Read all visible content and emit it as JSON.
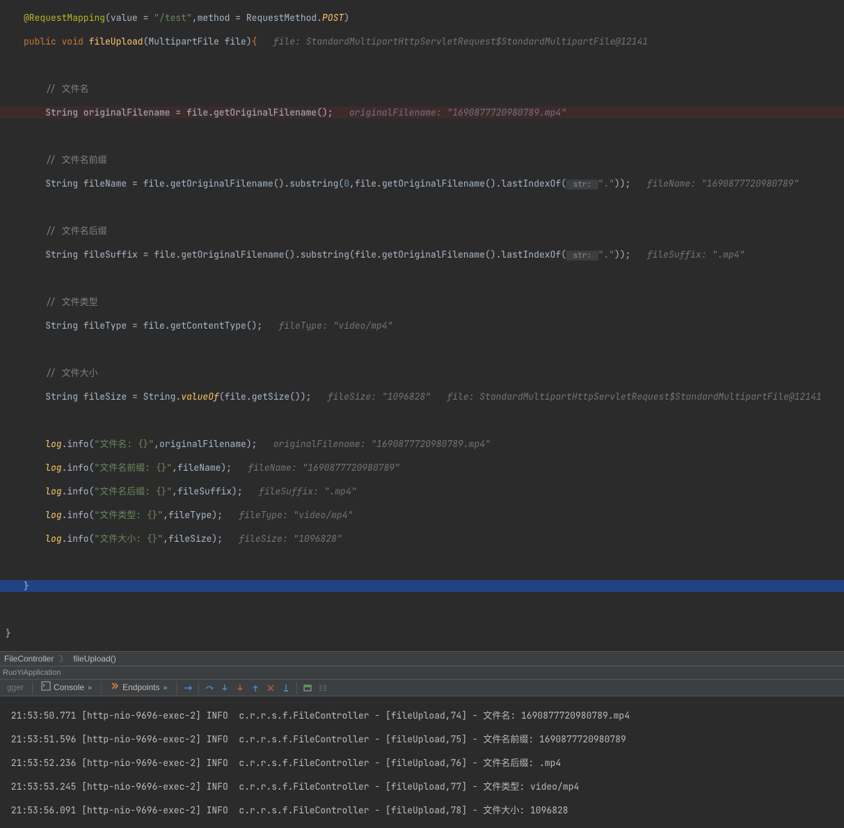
{
  "code": {
    "l1": {
      "ann": "@RequestMapping",
      "p1": "(value = ",
      "s1": "\"/test\"",
      "p2": ",method = RequestMethod.",
      "en": "POST",
      "p3": ")"
    },
    "l2": {
      "mods": "public void ",
      "name": "fileUpload",
      "sig": "(MultipartFile file)",
      "ob": "{",
      "hint": "   file: StandardMultipartHttpServletRequest$StandardMultipartFile@12141"
    },
    "l3": "",
    "l4": {
      "c": "    // 文件名"
    },
    "l5": {
      "t": "    String originalFilename = file.getOriginalFilename();",
      "h": "   originalFilename: \"1690877720980789.mp4\""
    },
    "l6": "",
    "l7": {
      "c": "    // 文件名前缀"
    },
    "l8": {
      "pre": "    String fileName = file.getOriginalFilename().substring(",
      "n": "0",
      "mid": ",file.getOriginalFilename().lastIndexOf(",
      "ph": " str: ",
      "s": "\".\"",
      "post": "));",
      "h": "   fileName: \"1690877720980789\""
    },
    "l9": "",
    "l10": {
      "c": "    // 文件名后缀"
    },
    "l11": {
      "pre": "    String fileSuffix = file.getOriginalFilename().substring(file.getOriginalFilename().lastIndexOf(",
      "ph": " str: ",
      "s": "\".\"",
      "post": "));",
      "h": "   fileSuffix: \".mp4\""
    },
    "l12": "",
    "l13": {
      "c": "    // 文件类型"
    },
    "l14": {
      "t": "    String fileType = file.getContentType();",
      "h": "   fileType: \"video/mp4\""
    },
    "l15": "",
    "l16": {
      "c": "    // 文件大小"
    },
    "l17": {
      "pre": "    String fileSize = String.",
      "m": "valueOf",
      "post": "(file.getSize());",
      "h": "   fileSize: \"1096828\"   file: StandardMultipartHttpServletRequest$StandardMultipartFile@12141"
    },
    "l18": "",
    "l19": {
      "log": "    log",
      "call": ".info(",
      "s": "\"文件名: {}\"",
      "mid": ",originalFilename);",
      "h": "   originalFilename: \"1690877720980789.mp4\""
    },
    "l20": {
      "log": "    log",
      "call": ".info(",
      "s": "\"文件名前缀: {}\"",
      "mid": ",fileName);",
      "h": "   fileName: \"1690877720980789\""
    },
    "l21": {
      "log": "    log",
      "call": ".info(",
      "s": "\"文件名后缀: {}\"",
      "mid": ",fileSuffix);",
      "h": "   fileSuffix: \".mp4\""
    },
    "l22": {
      "log": "    log",
      "call": ".info(",
      "s": "\"文件类型: {}\"",
      "mid": ",fileType);",
      "h": "   fileType: \"video/mp4\""
    },
    "l23": {
      "log": "    log",
      "call": ".info(",
      "s": "\"文件大小: {}\"",
      "mid": ",fileSize);",
      "h": "   fileSize: \"1096828\""
    },
    "l24": "",
    "l25": "}",
    "l26": "",
    "l27_outer": "}"
  },
  "breadcrumb": {
    "class": "FileController",
    "method": "fileUpload()"
  },
  "debug": {
    "title": "RuoYiApplication",
    "tab_console": "Console",
    "tab_endpoints": "Endpoints"
  },
  "console": {
    "r1": " 21:53:50.771 [http-nio-9696-exec-2] INFO  c.r.r.s.f.FileController - [fileUpload,74] - 文件名: 1690877720980789.mp4",
    "r2": " 21:53:51.596 [http-nio-9696-exec-2] INFO  c.r.r.s.f.FileController - [fileUpload,75] - 文件名前缀: 1690877720980789",
    "r3": " 21:53:52.236 [http-nio-9696-exec-2] INFO  c.r.r.s.f.FileController - [fileUpload,76] - 文件名后缀: .mp4",
    "r4": " 21:53:53.245 [http-nio-9696-exec-2] INFO  c.r.r.s.f.FileController - [fileUpload,77] - 文件类型: video/mp4",
    "r5": " 21:53:56.091 [http-nio-9696-exec-2] INFO  c.r.r.s.f.FileController - [fileUpload,78] - 文件大小: 1096828"
  }
}
